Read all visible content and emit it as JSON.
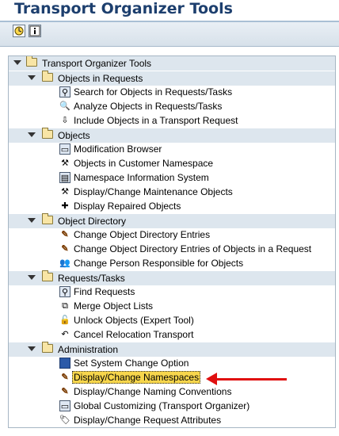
{
  "title": "Transport Organizer Tools",
  "toolbar": {
    "buttons": [
      {
        "icon": "execute-icon"
      },
      {
        "icon": "info-icon"
      }
    ]
  },
  "tree": {
    "root": "Transport Organizer Tools",
    "sections": [
      {
        "label": "Objects in Requests",
        "items": [
          {
            "label": "Search for Objects in Requests/Tasks",
            "icon": "binoculars-icon"
          },
          {
            "label": "Analyze Objects in Requests/Tasks",
            "icon": "magnifier-icon"
          },
          {
            "label": "Include Objects in a Transport Request",
            "icon": "include-icon"
          }
        ]
      },
      {
        "label": "Objects",
        "items": [
          {
            "label": "Modification Browser",
            "icon": "browser-icon"
          },
          {
            "label": "Objects in Customer Namespace",
            "icon": "tools-icon"
          },
          {
            "label": "Namespace Information System",
            "icon": "info-system-icon"
          },
          {
            "label": "Display/Change Maintenance Objects",
            "icon": "tools-icon"
          },
          {
            "label": "Display Repaired Objects",
            "icon": "repaired-icon"
          }
        ]
      },
      {
        "label": "Object Directory",
        "items": [
          {
            "label": "Change Object Directory Entries",
            "icon": "pencil-icon"
          },
          {
            "label": "Change Object Directory Entries of Objects in a Request",
            "icon": "pencil-icon"
          },
          {
            "label": "Change Person Responsible for Objects",
            "icon": "people-icon"
          }
        ]
      },
      {
        "label": "Requests/Tasks",
        "items": [
          {
            "label": "Find Requests",
            "icon": "binoculars-icon"
          },
          {
            "label": "Merge Object Lists",
            "icon": "merge-icon"
          },
          {
            "label": "Unlock Objects (Expert Tool)",
            "icon": "lock-icon"
          },
          {
            "label": "Cancel Relocation Transport",
            "icon": "cancel-icon"
          }
        ]
      },
      {
        "label": "Administration",
        "items": [
          {
            "label": "Set System Change Option",
            "icon": "system-icon"
          },
          {
            "label": "Display/Change Namespaces",
            "icon": "pencil-icon",
            "selected": true
          },
          {
            "label": "Display/Change Naming Conventions",
            "icon": "pencil-icon"
          },
          {
            "label": "Global Customizing (Transport Organizer)",
            "icon": "browser-icon"
          },
          {
            "label": "Display/Change Request Attributes",
            "icon": "tag-icon"
          }
        ]
      }
    ]
  },
  "colors": {
    "title": "#1d3f6e",
    "section_bg": "#dde6ee",
    "selection": "#f7d64c",
    "arrow": "#e01010"
  }
}
